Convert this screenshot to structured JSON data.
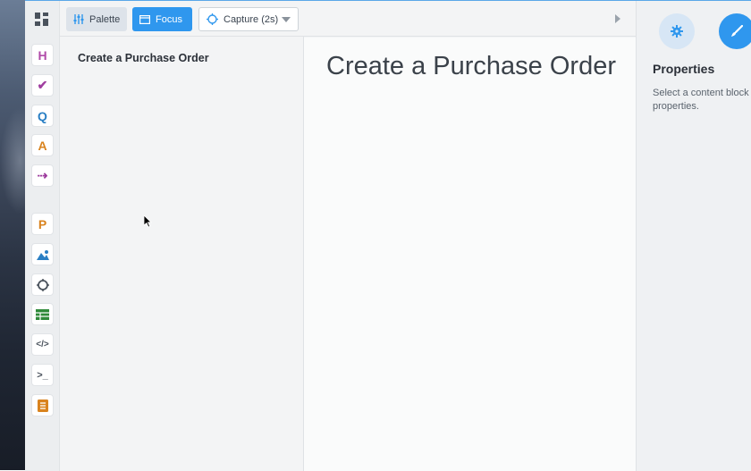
{
  "toolbar": {
    "palette_label": "Palette",
    "focus_label": "Focus",
    "capture_label": "Capture (2s)"
  },
  "rail": {
    "items": [
      {
        "icon": "heading-icon",
        "glyph": "H",
        "color": "#b04aa8"
      },
      {
        "icon": "checkmark-icon",
        "glyph": "✔",
        "color": "#a03ea0"
      },
      {
        "icon": "question-icon",
        "glyph": "Q",
        "color": "#2a7fc4"
      },
      {
        "icon": "answer-icon",
        "glyph": "A",
        "color": "#d9831e"
      },
      {
        "icon": "flow-arrow-icon",
        "glyph": "⇢",
        "color": "#9c3a9c"
      },
      {
        "icon": "p-icon",
        "glyph": "P",
        "color": "#d9831e"
      },
      {
        "icon": "image-icon",
        "glyph": "▲",
        "color": "#2a7fc4"
      },
      {
        "icon": "circle-icon",
        "glyph": "○",
        "color": "#4a525c"
      },
      {
        "icon": "table-icon",
        "glyph": "▦",
        "color": "#2f8a3a"
      },
      {
        "icon": "code-icon",
        "glyph": "</>",
        "color": "#4a525c"
      },
      {
        "icon": "terminal-icon",
        "glyph": ">_",
        "color": "#4a525c"
      },
      {
        "icon": "document-icon",
        "glyph": "≡",
        "color": "#d9831e"
      }
    ]
  },
  "outline": {
    "title": "Create a Purchase Order"
  },
  "editor": {
    "title": "Create a Purchase Order"
  },
  "properties": {
    "title": "Properties",
    "hint": "Select a content block properties."
  },
  "colors": {
    "accent": "#2f97ee"
  }
}
